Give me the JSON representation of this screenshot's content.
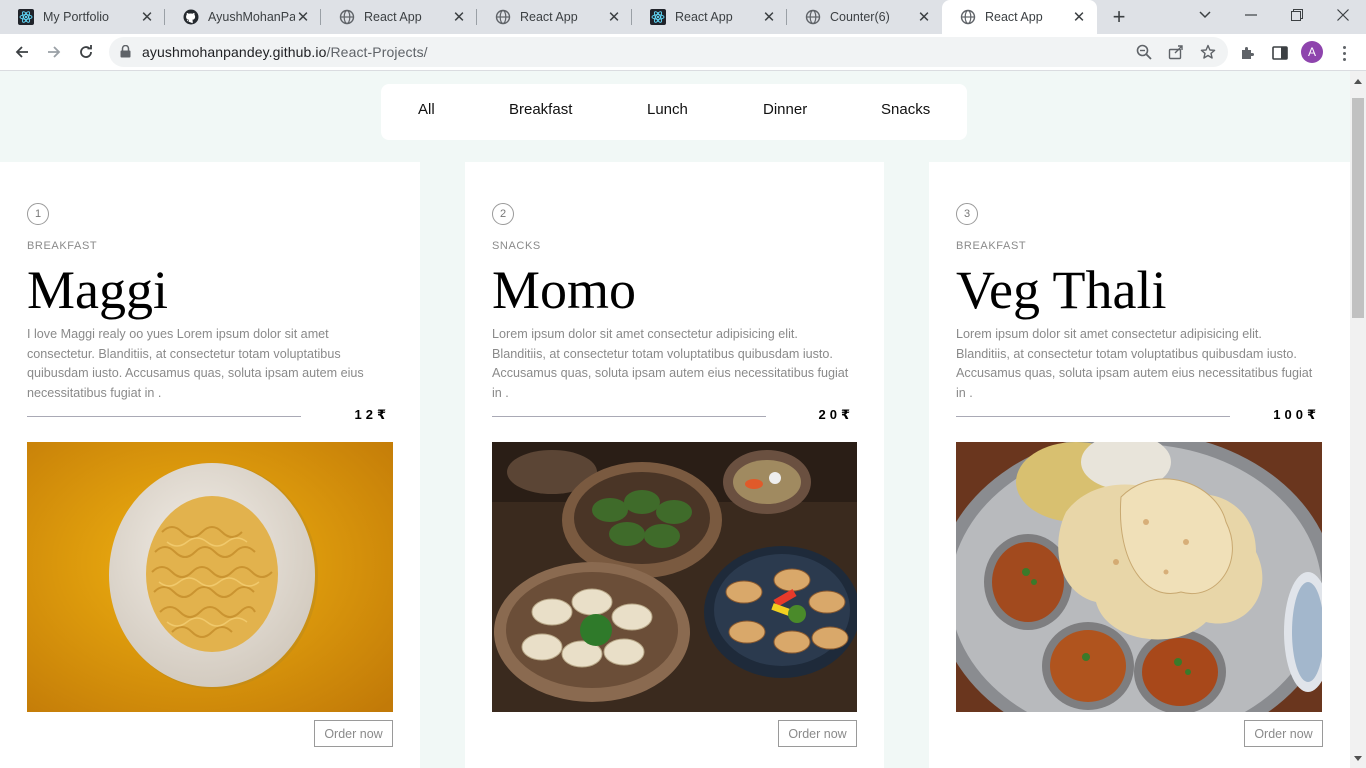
{
  "browser": {
    "tabs": [
      {
        "title": "My Portfolio",
        "favicon": "react-icon"
      },
      {
        "title": "AyushMohanPandey",
        "favicon": "github-icon"
      },
      {
        "title": "React App",
        "favicon": "globe-icon"
      },
      {
        "title": "React App",
        "favicon": "globe-icon"
      },
      {
        "title": "React App",
        "favicon": "react-icon"
      },
      {
        "title": "Counter(6)",
        "favicon": "globe-icon"
      },
      {
        "title": "React App",
        "favicon": "globe-icon",
        "active": true
      }
    ],
    "url_host": "ayushmohanpandey.github.io",
    "url_path": "/React-Projects/",
    "profile_initial": "A",
    "profile_color": "#8e44ad"
  },
  "menu": {
    "items": [
      "All",
      "Breakfast",
      "Lunch",
      "Dinner",
      "Snacks"
    ]
  },
  "cards": [
    {
      "number": "1",
      "category": "BREAKFAST",
      "title": "Maggi",
      "description": "I love Maggi realy oo yues Lorem ipsum dolor sit amet consectetur. Blanditiis, at consectetur totam voluptatibus quibusdam iusto. Accusamus quas, soluta ipsam autem eius necessitatibus fugiat in .",
      "price": "12₹",
      "image": "maggi-photo",
      "order_label": "Order now"
    },
    {
      "number": "2",
      "category": "SNACKS",
      "title": "Momo",
      "description": "Lorem ipsum dolor sit amet consectetur adipisicing elit. Blanditiis, at consectetur totam voluptatibus quibusdam iusto. Accusamus quas, soluta ipsam autem eius necessitatibus fugiat in .",
      "price": "20₹",
      "image": "momo-photo",
      "order_label": "Order now"
    },
    {
      "number": "3",
      "category": "BREAKFAST",
      "title": "Veg Thali",
      "description": "Lorem ipsum dolor sit amet consectetur adipisicing elit. Blanditiis, at consectetur totam voluptatibus quibusdam iusto. Accusamus quas, soluta ipsam autem eius necessitatibus fugiat in .",
      "price": "100₹",
      "image": "thali-photo",
      "order_label": "Order now"
    }
  ],
  "colors": {
    "page_background": "#f1f8f6",
    "card_background": "#ffffff",
    "muted_text": "#8a8a8a"
  }
}
